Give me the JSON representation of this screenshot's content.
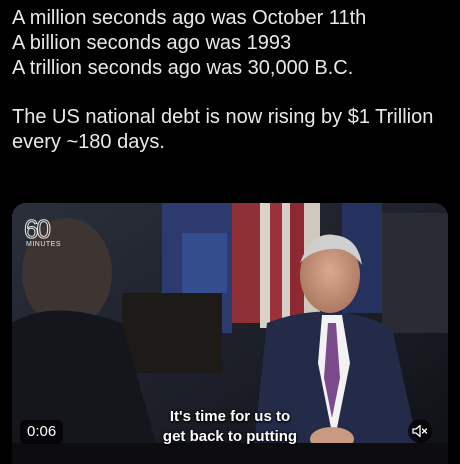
{
  "post": {
    "lines": [
      "A million seconds ago was October 11th",
      "A billion seconds ago was 1993",
      "A trillion seconds ago was 30,000 B.C.",
      "The US national debt is now rising by $1 Trillion",
      "every ~180 days."
    ]
  },
  "video": {
    "logo_number": "60",
    "logo_word": "MINUTES",
    "caption_lines": [
      "It's time for us to",
      "get back to putting"
    ],
    "timestamp": "0:06",
    "mute_icon": "speaker-muted-icon"
  }
}
